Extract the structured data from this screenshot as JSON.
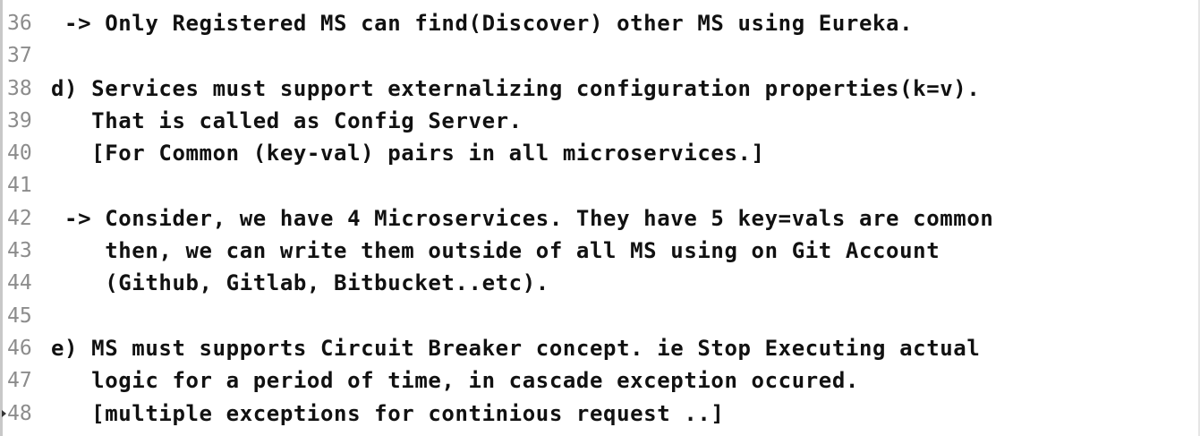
{
  "lines": [
    {
      "num": "36",
      "text": " -> Only Registered MS can find(Discover) other MS using Eureka."
    },
    {
      "num": "37",
      "text": ""
    },
    {
      "num": "38",
      "text": "d) Services must support externalizing configuration properties(k=v)."
    },
    {
      "num": "39",
      "text": "   That is called as Config Server."
    },
    {
      "num": "40",
      "text": "   [For Common (key-val) pairs in all microservices.]"
    },
    {
      "num": "41",
      "text": ""
    },
    {
      "num": "42",
      "text": " -> Consider, we have 4 Microservices. They have 5 key=vals are common"
    },
    {
      "num": "43",
      "text": "    then, we can write them outside of all MS using on Git Account"
    },
    {
      "num": "44",
      "text": "    (Github, Gitlab, Bitbucket..etc)."
    },
    {
      "num": "45",
      "text": ""
    },
    {
      "num": "46",
      "text": "e) MS must supports Circuit Breaker concept. ie Stop Executing actual"
    },
    {
      "num": "47",
      "text": "   logic for a period of time, in cascade exception occured."
    },
    {
      "num": "48",
      "text": "   [multiple exceptions for continious request ..]"
    }
  ]
}
